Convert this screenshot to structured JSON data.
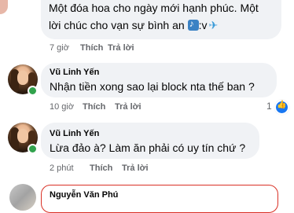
{
  "comments": [
    {
      "text_line1": "Một đóa hoa cho ngày mới hạnh phúc. Một",
      "text_line2": "lời chúc cho vạn sự bình an",
      "text_suffix": ":v",
      "time": "7 giờ",
      "like_label": "Thích",
      "reply_label": "Trả lời"
    },
    {
      "author": "Vũ Linh Yến",
      "text": "Nhận tiền xong sao lại block nta thế ban ?",
      "time": "10 giờ",
      "like_label": "Thích",
      "reply_label": "Trả lời",
      "reaction_count": "1"
    },
    {
      "author": "Vũ Linh Yến",
      "text": "Lừa đảo à? Làm ăn phải có uy tín chứ ?",
      "time": "2 phút",
      "like_label": "Thích",
      "reply_label": "Trả lời"
    }
  ],
  "reply": {
    "author": "Nguyễn Văn Phú"
  },
  "colors": {
    "bubble_bg": "#f0f2f5",
    "meta_text": "#65676b",
    "online_dot": "#31a24c",
    "like_blue": "#1877f2",
    "reply_border": "#d93025"
  }
}
